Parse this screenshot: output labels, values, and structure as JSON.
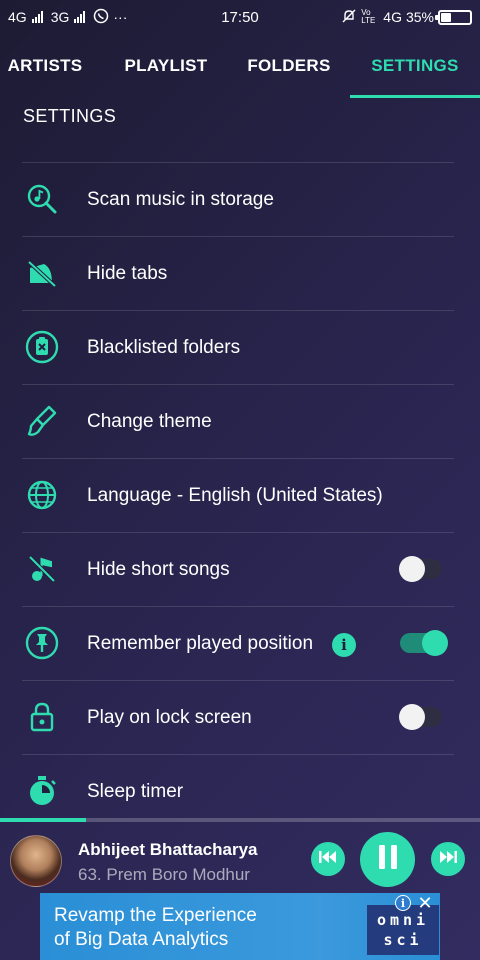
{
  "status_bar": {
    "network_1": "4G",
    "network_2": "3G",
    "more": "···",
    "time": "17:50",
    "volte": "Vo LTE",
    "network_3": "4G",
    "battery_text": "35%",
    "battery_level": 0.35
  },
  "tabs": [
    {
      "label": "ARTISTS",
      "active": false
    },
    {
      "label": "PLAYLIST",
      "active": false
    },
    {
      "label": "FOLDERS",
      "active": false
    },
    {
      "label": "SETTINGS",
      "active": true
    }
  ],
  "section_title": "SETTINGS",
  "settings": [
    {
      "label": "Scan music in storage",
      "icon": "music-search-icon"
    },
    {
      "label": "Hide tabs",
      "icon": "hide-tabs-icon"
    },
    {
      "label": "Blacklisted folders",
      "icon": "blacklist-icon"
    },
    {
      "label": "Change theme",
      "icon": "paint-brush-icon"
    },
    {
      "label": "Language - English (United States)",
      "icon": "globe-icon"
    },
    {
      "label": "Hide short songs",
      "icon": "music-off-icon",
      "toggle": false
    },
    {
      "label": "Remember played position",
      "icon": "pin-icon",
      "toggle": true,
      "info": "i"
    },
    {
      "label": "Play on lock screen",
      "icon": "lock-icon",
      "toggle": false
    },
    {
      "label": "Sleep timer",
      "icon": "timer-icon"
    }
  ],
  "player": {
    "artist": "Abhijeet Bhattacharya",
    "song": "63. Prem Boro Modhur",
    "progress": 0.18
  },
  "ad": {
    "line1": "Revamp the Experience",
    "line2": "of Big Data Analytics",
    "logo_line1": "omni",
    "logo_line2": "sci",
    "info": "i",
    "close": "✕"
  },
  "colors": {
    "accent": "#2fdcb0",
    "background": "#241f45",
    "ad_background": "#3b99dc"
  }
}
